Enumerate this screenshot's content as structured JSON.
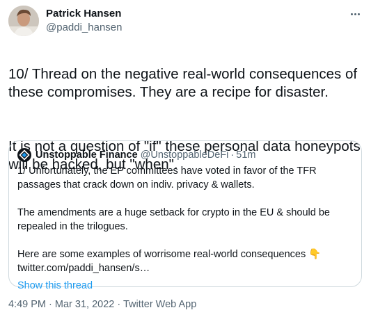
{
  "author": {
    "display_name": "Patrick Hansen",
    "handle": "@paddi_hansen",
    "avatar_icon": "profile-photo"
  },
  "more_icon": "ellipsis-icon",
  "tweet": {
    "paragraph_1": "10/ Thread on the negative real-world consequences of these compromises. They are a recipe for disaster.",
    "paragraph_2": "It is not a question of \"if\" these personal data honeypots will be hacked, but \"when\"."
  },
  "quoted_tweet": {
    "display_name": "Unstoppable Finance",
    "handle": "@UnstoppableDeFi",
    "separator": "·",
    "time": "51m",
    "paragraph_1": "1/ Unfortunately, the EP committees have voted in favor of the TFR passages that crack down on indiv. privacy & wallets.",
    "paragraph_2": "The amendments are a huge setback for crypto in the EU & should be repealed in the trilogues.",
    "paragraph_3": "Here are some examples of worrisome real-world consequences 👇 twitter.com/paddi_hansen/s…",
    "show_thread": "Show this thread",
    "logo_color": "#0f1419"
  },
  "footer": {
    "timestamp": "4:49 PM · Mar 31, 2022 · Twitter Web App"
  },
  "colors": {
    "text": "#0f1419",
    "secondary": "#536471",
    "link": "#1d9bf0",
    "border": "#cfd9de"
  }
}
